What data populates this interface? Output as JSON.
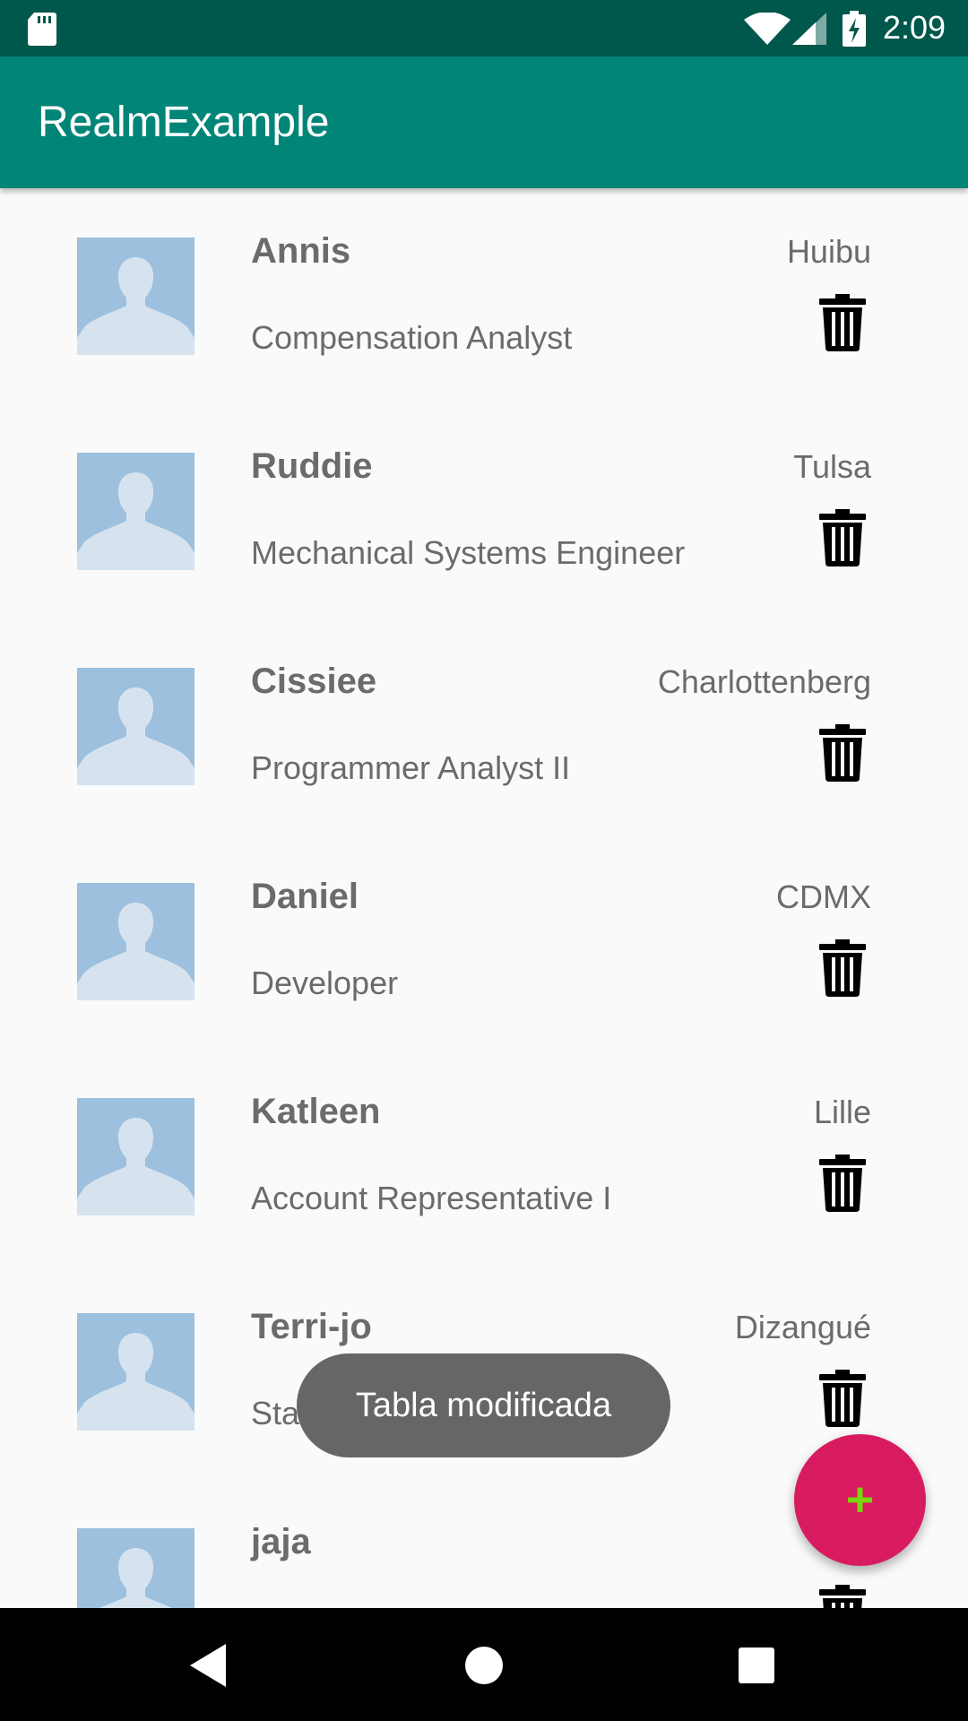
{
  "status_bar": {
    "time": "2:09",
    "icons": [
      "sd-card-icon",
      "wifi-icon",
      "signal-icon",
      "battery-charging-icon"
    ]
  },
  "app_bar": {
    "title": "RealmExample"
  },
  "people": [
    {
      "name": "Annis",
      "job": "Compensation Analyst",
      "city": "Huibu"
    },
    {
      "name": "Ruddie",
      "job": "Mechanical Systems Engineer",
      "city": "Tulsa"
    },
    {
      "name": "Cissiee",
      "job": "Programmer Analyst II",
      "city": "Charlottenberg"
    },
    {
      "name": "Daniel",
      "job": "Developer",
      "city": "CDMX"
    },
    {
      "name": "Katleen",
      "job": "Account Representative I",
      "city": "Lille"
    },
    {
      "name": "Terri-jo",
      "job": "Statistician",
      "city": "Dizangué"
    },
    {
      "name": "jaja",
      "job": "",
      "city": ""
    }
  ],
  "toast": {
    "message": "Tabla modificada"
  },
  "fab": {
    "label": "+",
    "accent": "#d81b60",
    "icon_color": "#7bd40e"
  },
  "colors": {
    "primary": "#008577",
    "primary_dark": "#00574b"
  }
}
